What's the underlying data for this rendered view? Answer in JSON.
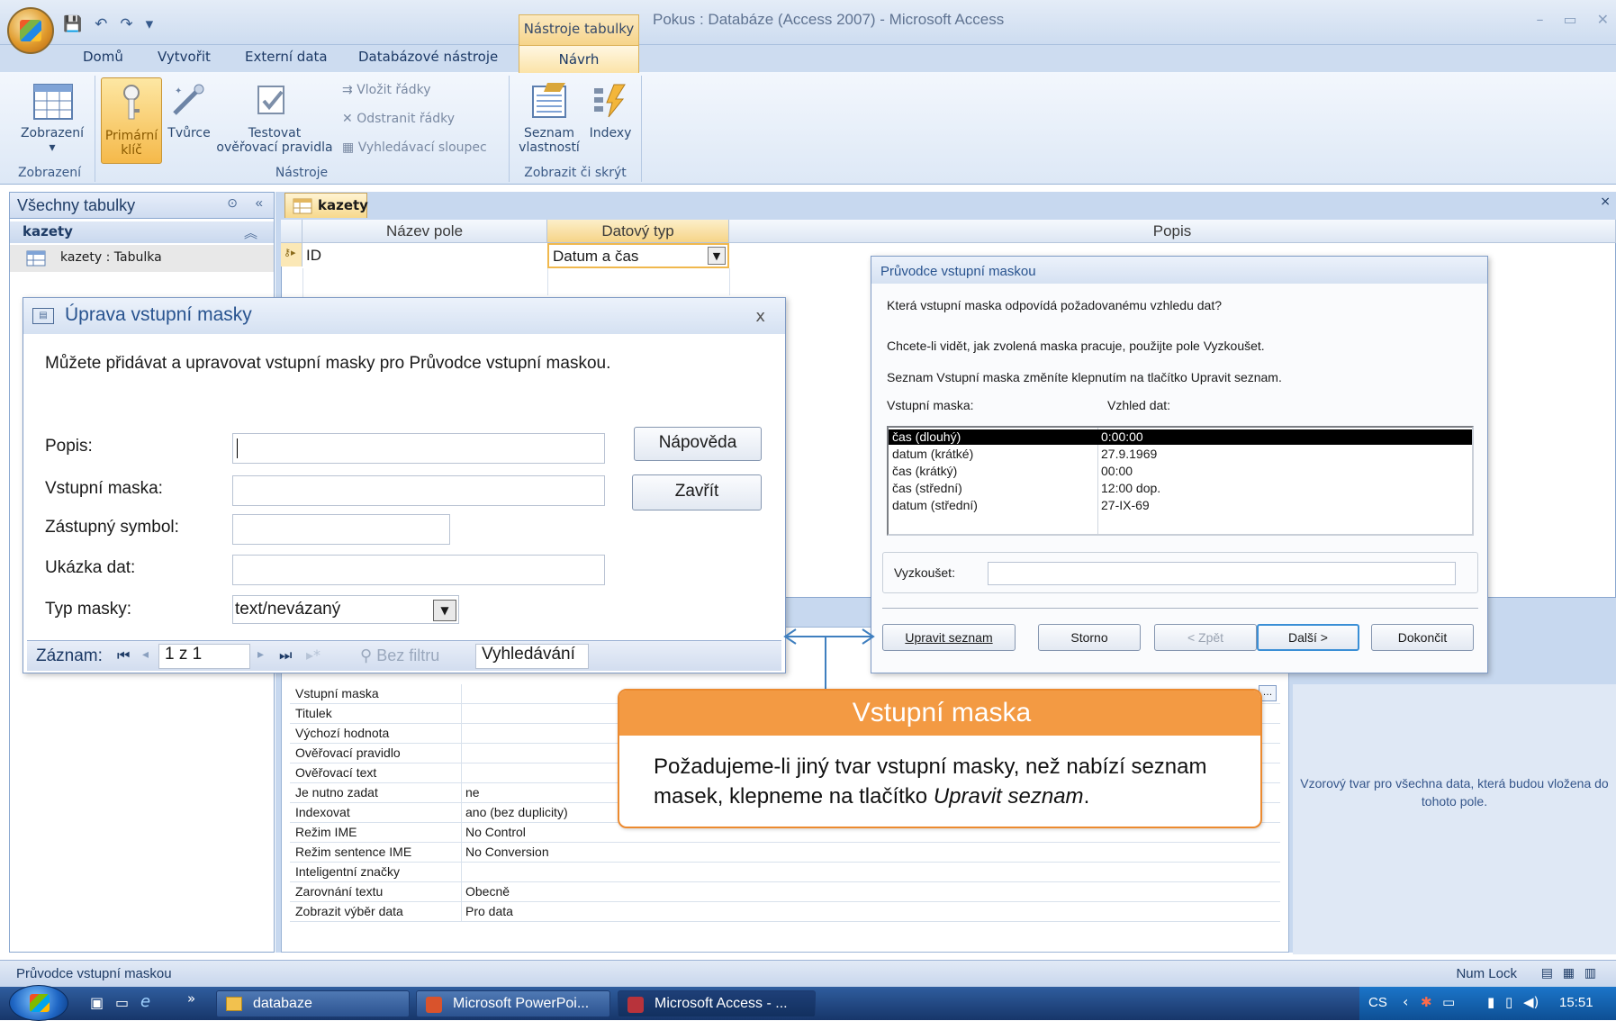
{
  "window": {
    "title": "Pokus : Databáze (Access 2007) - Microsoft Access",
    "contextual_tab_group": "Nástroje tabulky",
    "minimize_glyph": "–",
    "restore_glyph": "▭",
    "close_glyph": "✕"
  },
  "ribbon": {
    "tabs": [
      "Domů",
      "Vytvořit",
      "Externí data",
      "Databázové nástroje"
    ],
    "active_tab": "Návrh",
    "groups": {
      "zobrazeni": {
        "label": "Zobrazení",
        "buttons": {
          "view": "Zobrazení"
        }
      },
      "nastroje": {
        "label": "Nástroje",
        "buttons": {
          "primary_key_1": "Primární",
          "primary_key_2": "klíč",
          "builder": "Tvůrce",
          "test_rules_1": "Testovat",
          "test_rules_2": "ověřovací pravidla",
          "insert_rows": "Vložit řádky",
          "delete_rows": "Odstranit řádky",
          "lookup_column": "Vyhledávací sloupec"
        }
      },
      "zobrazit": {
        "label": "Zobrazit či skrýt",
        "buttons": {
          "property_sheet_1": "Seznam",
          "property_sheet_2": "vlastností",
          "indexes": "Indexy"
        }
      }
    }
  },
  "nav_pane": {
    "header": "Všechny tabulky",
    "group": "kazety",
    "item": "kazety : Tabulka"
  },
  "document": {
    "tab": "kazety",
    "columns": [
      "Název pole",
      "Datový typ",
      "Popis"
    ],
    "row": {
      "field": "ID",
      "type": "Datum a čas"
    }
  },
  "properties": [
    {
      "label": "Vstupní maska",
      "value": ""
    },
    {
      "label": "Titulek",
      "value": ""
    },
    {
      "label": "Výchozí hodnota",
      "value": ""
    },
    {
      "label": "Ověřovací pravidlo",
      "value": ""
    },
    {
      "label": "Ověřovací text",
      "value": ""
    },
    {
      "label": "Je nutno zadat",
      "value": "ne"
    },
    {
      "label": "Indexovat",
      "value": "ano (bez duplicity)"
    },
    {
      "label": "Režim IME",
      "value": "No Control"
    },
    {
      "label": "Režim sentence IME",
      "value": "No Conversion"
    },
    {
      "label": "Inteligentní značky",
      "value": ""
    },
    {
      "label": "Zarovnání textu",
      "value": "Obecně"
    },
    {
      "label": "Zobrazit výběr data",
      "value": "Pro data"
    }
  ],
  "hint": "Vzorový tvar pro všechna data, která budou vložena do tohoto pole.",
  "edit_dialog": {
    "title": "Úprava vstupní masky",
    "close": "x",
    "intro": "Můžete přidávat a upravovat vstupní masky pro Průvodce vstupní maskou.",
    "labels": {
      "popis": "Popis:",
      "maska": "Vstupní maska:",
      "symbol": "Zástupný symbol:",
      "ukazka": "Ukázka dat:",
      "typ": "Typ masky:"
    },
    "mask_type_value": "text/nevázaný",
    "help_btn": "Nápověda",
    "close_btn": "Zavřít",
    "record_nav": {
      "label": "Záznam:",
      "position": "1 z 1",
      "filter": "Bez filtru",
      "search": "Vyhledávání"
    }
  },
  "wizard": {
    "title": "Průvodce vstupní maskou",
    "q1": "Která vstupní maska odpovídá požadovanému vzhledu dat?",
    "q2": "Chcete-li vidět, jak zvolená maska pracuje, použijte pole Vyzkoušet.",
    "q3": "Seznam Vstupní maska změníte klepnutím na tlačítko Upravit seznam.",
    "col_mask": "Vstupní maska:",
    "col_look": "Vzhled dat:",
    "rows": [
      {
        "mask": "čas (dlouhý)",
        "look": "0:00:00"
      },
      {
        "mask": "datum (krátké)",
        "look": "27.9.1969"
      },
      {
        "mask": "čas (krátký)",
        "look": "00:00"
      },
      {
        "mask": "čas (střední)",
        "look": "12:00 dop."
      },
      {
        "mask": "datum (střední)",
        "look": "27-IX-69"
      }
    ],
    "try_label": "Vyzkoušet:",
    "buttons": {
      "edit_list": "Upravit seznam",
      "cancel": "Storno",
      "back": "< Zpět",
      "next": "Další >",
      "finish": "Dokončit"
    }
  },
  "callout": {
    "title": "Vstupní maska",
    "text_before": "Požadujeme-li jiný tvar vstupní masky, než nabízí seznam masek, klepneme na tlačítko ",
    "text_em": "Upravit seznam",
    "text_after": "."
  },
  "status": {
    "left": "Průvodce vstupní maskou",
    "numlock": "Num Lock"
  },
  "taskbar": {
    "buttons": [
      "databaze",
      "Microsoft PowerPoi...",
      "Microsoft Access - ..."
    ],
    "lang": "CS",
    "clock": "15:51"
  }
}
